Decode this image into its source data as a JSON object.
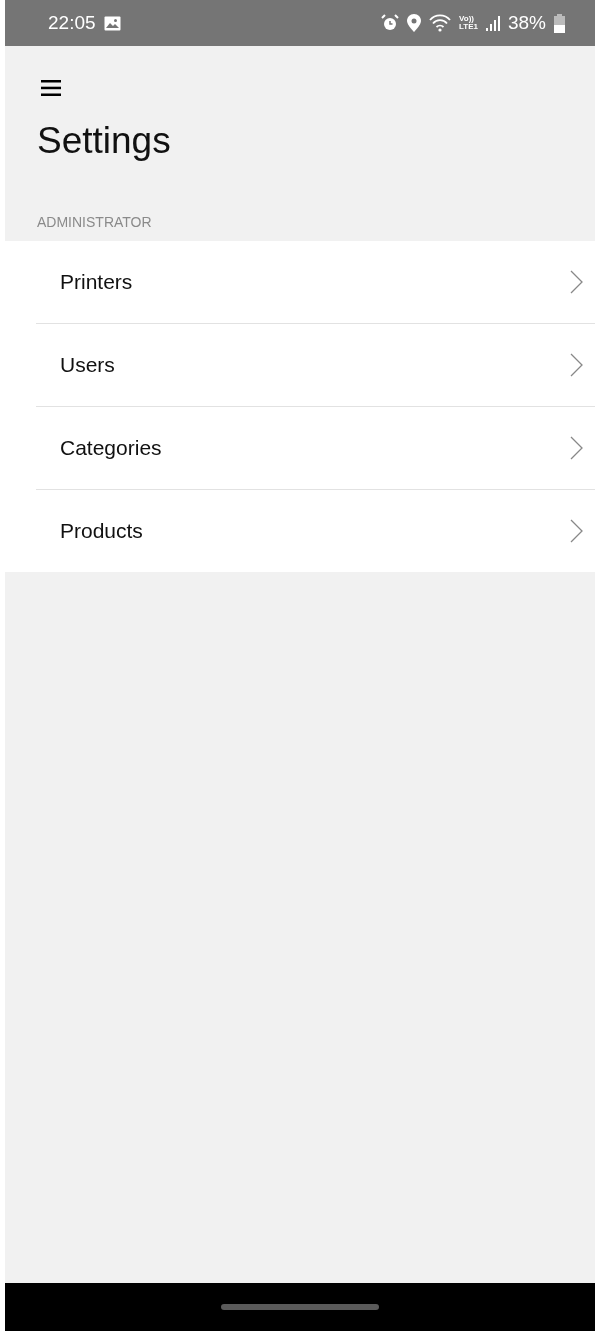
{
  "status_bar": {
    "time": "22:05",
    "volte": "Vo))",
    "network": "LTE1",
    "battery_text": "38%"
  },
  "header": {
    "title": "Settings"
  },
  "section": {
    "title": "ADMINISTRATOR",
    "items": [
      {
        "label": "Printers"
      },
      {
        "label": "Users"
      },
      {
        "label": "Categories"
      },
      {
        "label": "Products"
      }
    ]
  }
}
